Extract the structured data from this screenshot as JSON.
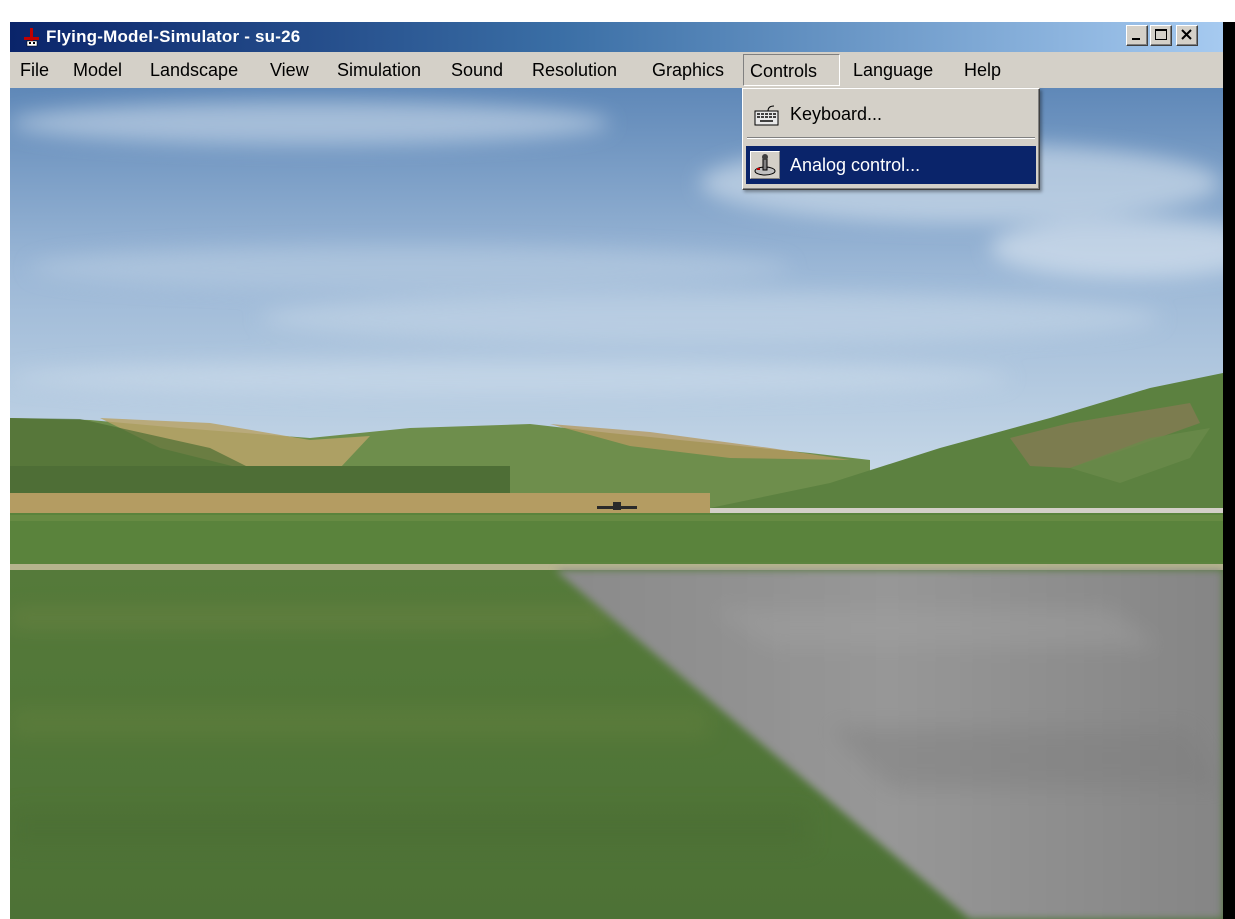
{
  "window": {
    "title": "Flying-Model-Simulator - su-26"
  },
  "menubar": {
    "items": [
      {
        "label": "File"
      },
      {
        "label": "Model"
      },
      {
        "label": "Landscape"
      },
      {
        "label": "View"
      },
      {
        "label": "Simulation"
      },
      {
        "label": "Sound"
      },
      {
        "label": "Resolution"
      },
      {
        "label": "Graphics"
      },
      {
        "label": "Controls"
      },
      {
        "label": "Language"
      },
      {
        "label": "Help"
      }
    ],
    "open_menu": "Controls"
  },
  "controls_menu": {
    "items": [
      {
        "label": "Keyboard...",
        "icon": "keyboard-icon"
      },
      {
        "label": "Analog control...",
        "icon": "joystick-icon",
        "highlighted": true
      }
    ]
  },
  "colors": {
    "titlebar_start": "#0a246a",
    "titlebar_end": "#a6caf0",
    "menu_highlight": "#0a246a",
    "chrome": "#d4d0c8",
    "sky_top": "#5f88b8",
    "grass": "#577a3c",
    "runway": "#8e8e8e"
  }
}
